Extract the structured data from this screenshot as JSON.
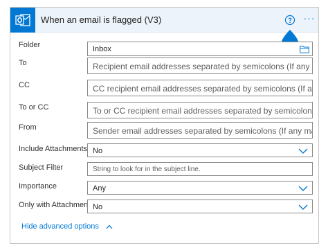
{
  "header": {
    "title": "When an email is flagged (V3)",
    "help_icon": "question-circle-icon",
    "more_icon": "ellipsis-icon",
    "more_glyph": "···",
    "app_icon": "outlook-icon",
    "accent_color": "#0078d4",
    "header_bg": "#edf3fa"
  },
  "fields": {
    "folder": {
      "label": "Folder",
      "value": "Inbox"
    },
    "to": {
      "label": "To",
      "placeholder": "Recipient email addresses separated by semicolons (If any match, the"
    },
    "cc": {
      "label": "CC",
      "placeholder": "CC recipient email addresses separated by semicolons (If any match,"
    },
    "to_or_cc": {
      "label": "To or CC",
      "placeholder": "To or CC recipient email addresses separated by semicolons (If any m"
    },
    "from": {
      "label": "From",
      "placeholder": "Sender email addresses separated by semicolons (If any match, the t"
    },
    "include_attachments": {
      "label": "Include Attachments",
      "value": "No"
    },
    "subject_filter": {
      "label": "Subject Filter",
      "placeholder": "String to look for in the subject line."
    },
    "importance": {
      "label": "Importance",
      "value": "Any"
    },
    "only_with_attachments": {
      "label": "Only with Attachments",
      "value": "No"
    }
  },
  "advanced": {
    "label": "Hide advanced options"
  }
}
